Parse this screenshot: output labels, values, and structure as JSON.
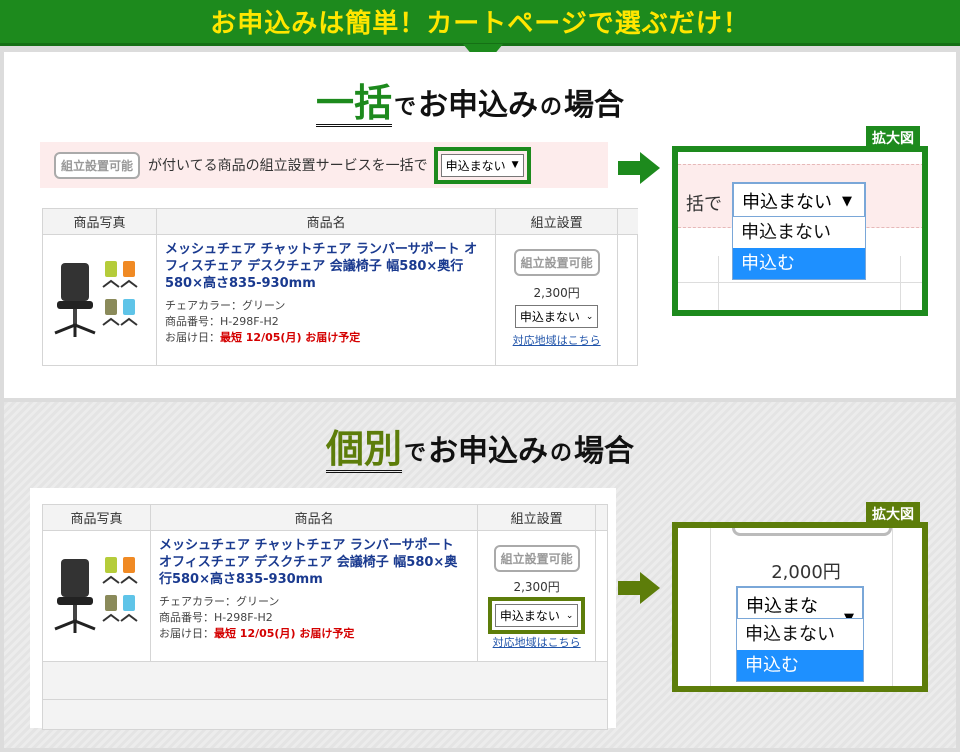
{
  "banner": {
    "title": "お申込みは簡単！カートページで選ぶだけ！"
  },
  "section_bulk": {
    "highlight": "一括",
    "de": "で",
    "rest": "お申込み",
    "no": "の",
    "case": "場合",
    "badge": "組立設置可能",
    "bar_text": "が付いてる商品の組立設置サービスを一括で",
    "select_value": "申込まない",
    "zoom_label": "拡大図",
    "zoom_prefix": "括で",
    "zoom_select": "申込まない",
    "options": [
      "申込まない",
      "申込む"
    ]
  },
  "section_individual": {
    "highlight": "個別",
    "de": "で",
    "rest": "お申込み",
    "no": "の",
    "case": "場合",
    "zoom_label": "拡大図",
    "zoom_price": "2,000円",
    "zoom_select": "申込まない",
    "options": [
      "申込まない",
      "申込む"
    ]
  },
  "table": {
    "headers": [
      "商品写真",
      "商品名",
      "組立設置"
    ],
    "product_name": "メッシュチェア チャットチェア ランバーサポート オフィスチェア デスクチェア 会議椅子 幅580×奥行580×高さ835-930mm",
    "color_line": "チェアカラー：グリーン",
    "code_line": "商品番号：H-298F-H2",
    "delivery_label": "お届け日：",
    "delivery_value": "最短 12/05(月) お届け予定",
    "badge": "組立設置可能",
    "price": "2,300円",
    "select_value": "申込まない",
    "area_link": "対応地域はこちら"
  },
  "colors": {
    "green": "#1d8a1d",
    "olive": "#5d7d0a",
    "banner_text": "#ffe600"
  }
}
